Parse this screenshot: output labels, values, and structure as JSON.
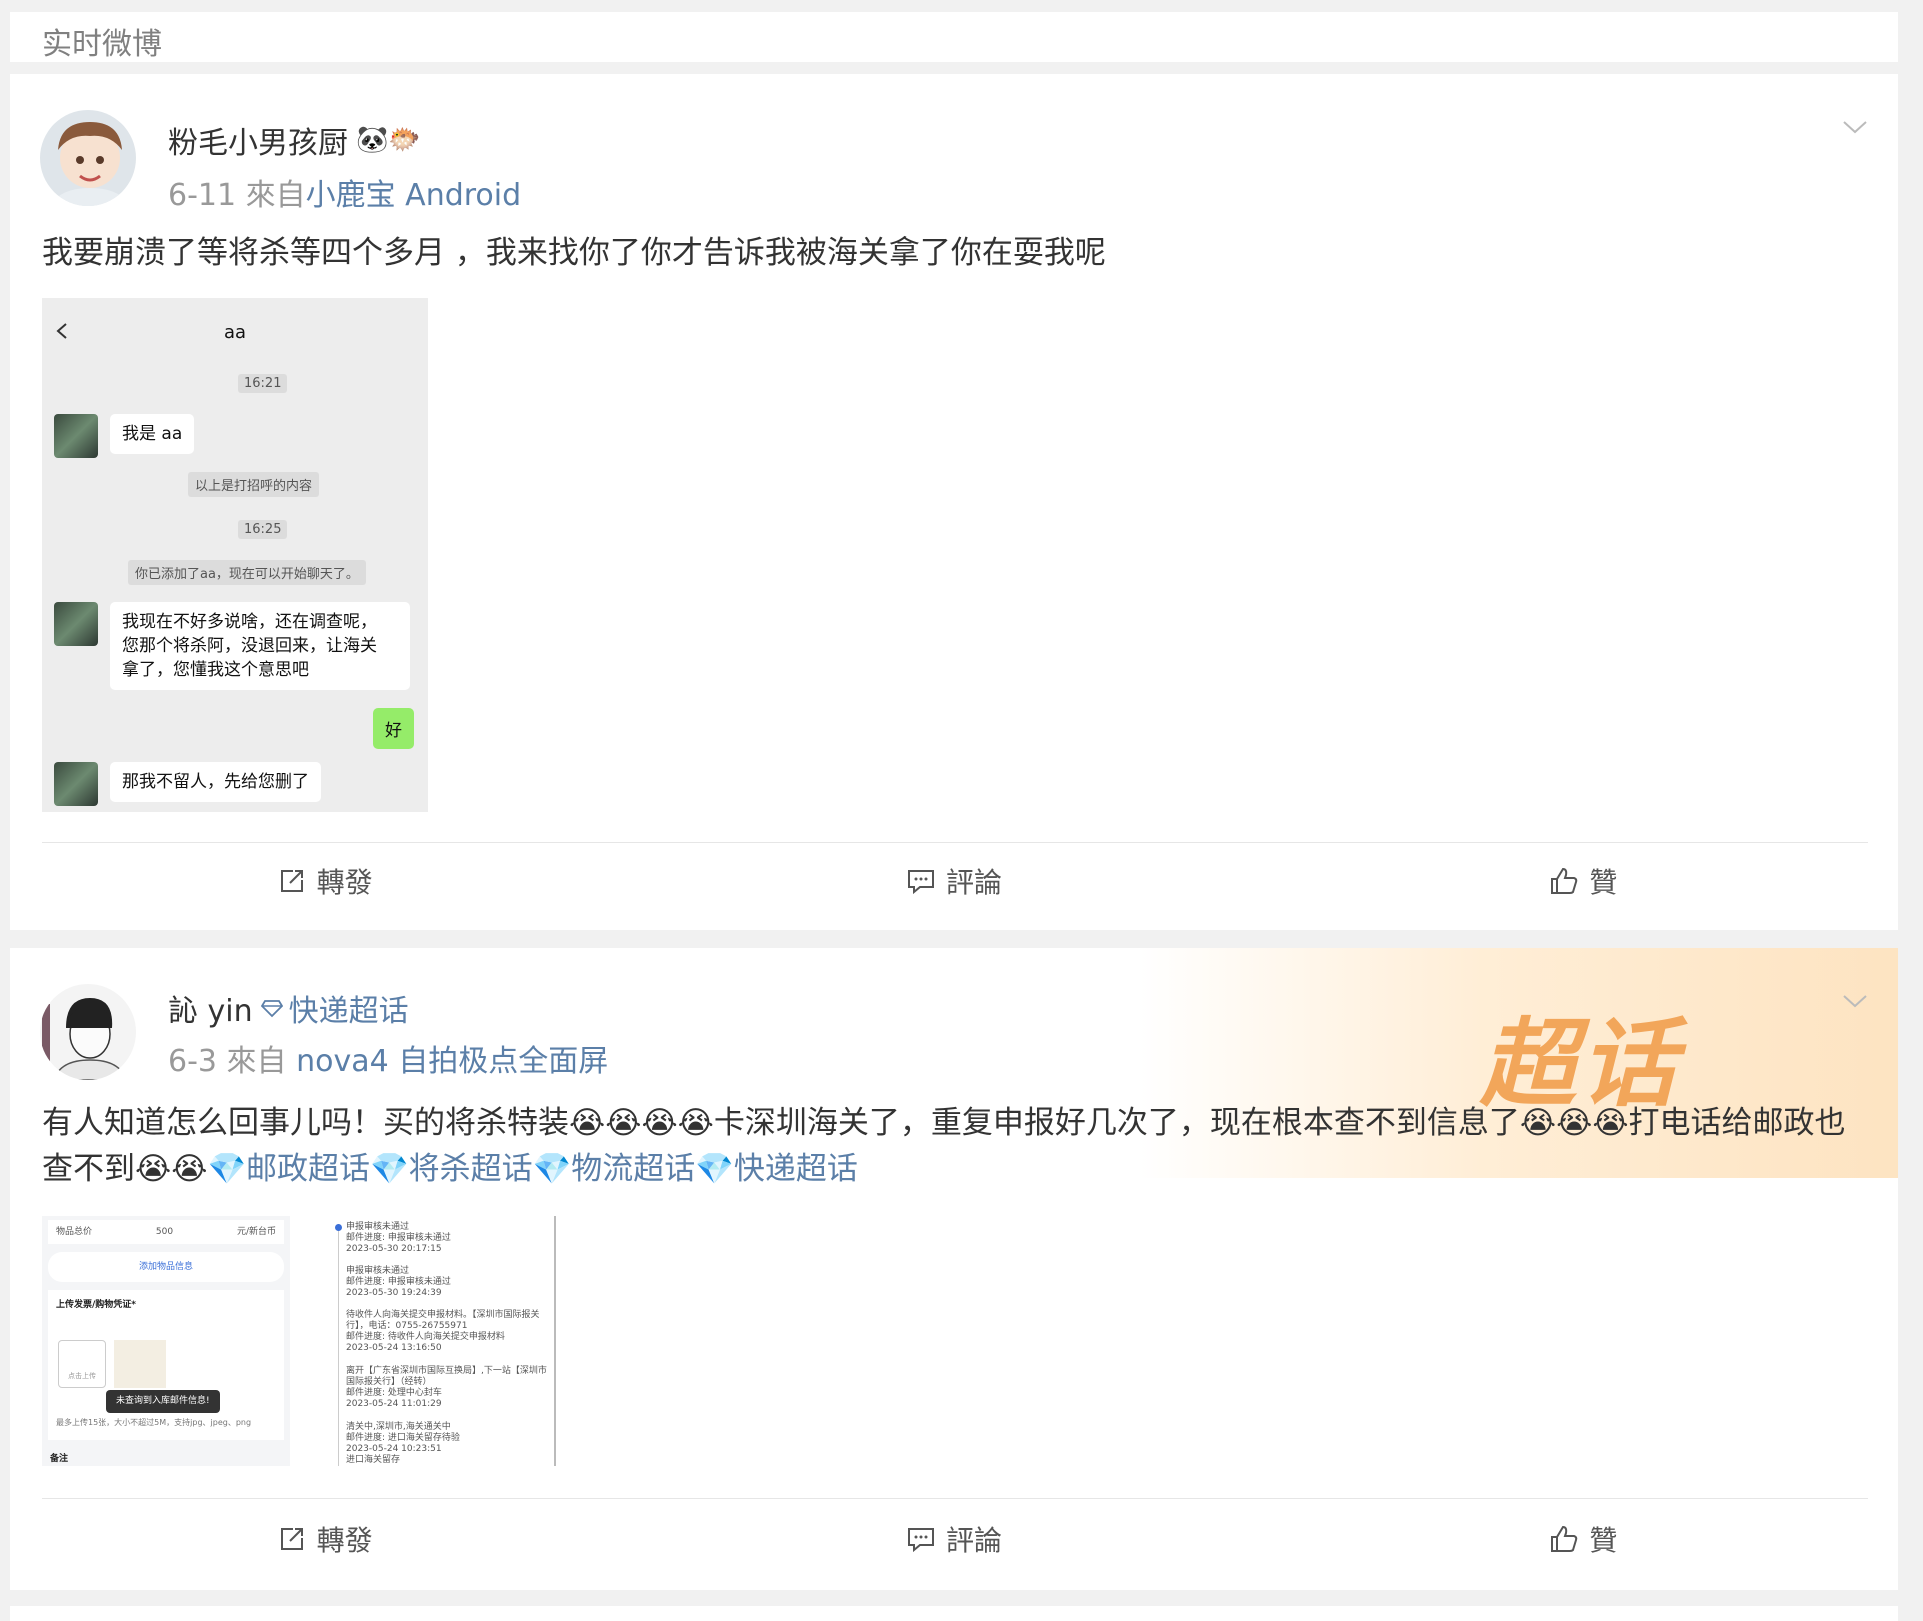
{
  "section": {
    "title": "实时微博"
  },
  "posts": [
    {
      "username": "粉毛小男孩厨",
      "emojis": "🐼🐡",
      "date": "6-11",
      "from_label": "來自",
      "source": "小鹿宝 Android",
      "text": "我要崩溃了等将杀等四个多月 ，我来找你了你才告诉我被海关拿了你在耍我呢",
      "image": {
        "chat_title": "aa",
        "time1": "16:21",
        "msg1": "我是 aa",
        "sys1": "以上是打招呼的内容",
        "time2": "16:25",
        "sys2": "你已添加了aa，现在可以开始聊天了。",
        "msg2_line1": "我现在不好多说啥，还在调查呢，",
        "msg2_line2": "您那个将杀阿，没退回来，让海关",
        "msg2_line3": "拿了，您懂我这个意思吧",
        "reply": "好",
        "msg3": "那我不留人，先给您删了"
      },
      "actions": {
        "repost": "轉發",
        "comment": "評論",
        "like": "贊"
      }
    },
    {
      "username": "訫 yin",
      "super_topic": "快递超话",
      "date": "6-3",
      "from_label": "來自",
      "source": "nova4 自拍极点全面屏",
      "text_part1": "有人知道怎么回事儿吗！买的将杀特装😭😭😭😭卡深圳海关了，重复申报好几次了，现在根本查不到信息了😭😭😭打电话给邮政也查不到😭😭",
      "tags": "💎邮政超话💎将杀超话💎物流超话💎快递超话",
      "banner": "超话",
      "form_image": {
        "total_label": "物品总价",
        "total_value": "500",
        "currency": "元/新台币",
        "add_item": "添加物品信息",
        "upload_label": "上传发票/购物凭证*",
        "upload_hint": "点击上传",
        "toast": "未查询到入库邮件信息!",
        "limit": "最多上传15张，大小不超过5M，支持jpg、jpeg、png",
        "note": "备注"
      },
      "track_image": {
        "e1": "申报审核未通过",
        "e1b": "邮件进度: 申报审核未通过",
        "e1c": "2023-05-30 20:17:15",
        "e2": "申报审核未通过",
        "e2b": "邮件进度: 申报审核未通过",
        "e2c": "2023-05-30 19:24:39",
        "e3": "待收件人向海关提交申报材料。【深圳市国际报关行】，电话：0755-26755971",
        "e3b": "邮件进度: 待收件人向海关提交申报材料",
        "e3c": "2023-05-24 13:16:50",
        "e4": "离开【广东省深圳市国际互换局】,下一站【深圳市国际报关行】（经转）",
        "e4b": "邮件进度: 处理中心封车",
        "e4c": "2023-05-24 11:01:29",
        "e5": "清关中,深圳市,海关通关中",
        "e5b": "邮件进度: 进口海关留存待验",
        "e5c": "2023-05-24 10:23:51",
        "e6": "进口海关留存"
      },
      "actions": {
        "repost": "轉發",
        "comment": "評論",
        "like": "贊"
      }
    }
  ]
}
